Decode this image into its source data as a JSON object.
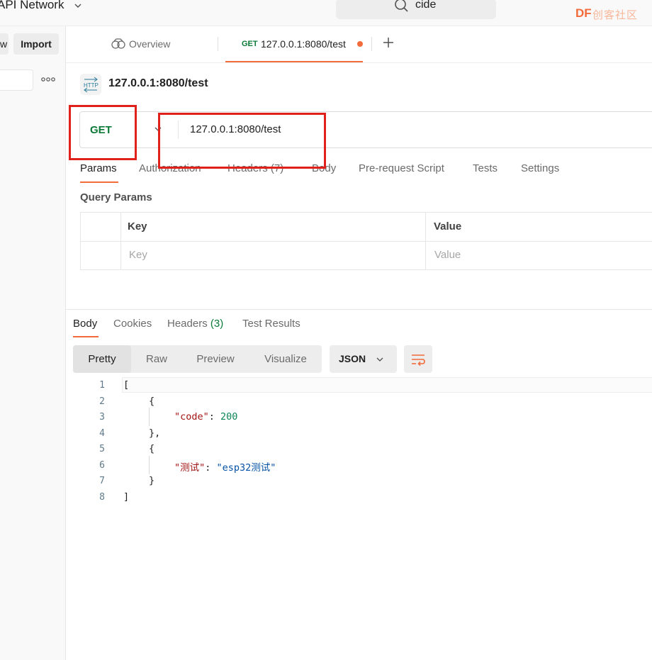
{
  "workspace": {
    "name": "API Network"
  },
  "search": {
    "value": "cide"
  },
  "brand": {
    "logo_text": "DF",
    "logo_sub": "创客社区"
  },
  "sidebar": {
    "left_button_label": "w",
    "import_label": "Import"
  },
  "tabs": {
    "overview_label": "Overview",
    "active_method": "GET",
    "active_url": "127.0.0.1:8080/test"
  },
  "request": {
    "title": "127.0.0.1:8080/test",
    "method": "GET",
    "url": "127.0.0.1:8080/test",
    "tabs": [
      "Params",
      "Authorization",
      "Headers (7)",
      "Body",
      "Pre-request Script",
      "Tests",
      "Settings"
    ],
    "active_tab": "Params",
    "query_params_title": "Query Params",
    "table": {
      "headers": [
        "Key",
        "Value"
      ],
      "placeholders": [
        "Key",
        "Value"
      ]
    }
  },
  "response": {
    "tabs": {
      "body": "Body",
      "cookies": "Cookies",
      "headers": "Headers",
      "headers_count": "(3)",
      "test_results": "Test Results"
    },
    "active_tab": "Body",
    "view_modes": [
      "Pretty",
      "Raw",
      "Preview",
      "Visualize"
    ],
    "active_view": "Pretty",
    "format": "JSON",
    "line_numbers": [
      "1",
      "2",
      "3",
      "4",
      "5",
      "6",
      "7",
      "8"
    ],
    "code": {
      "l1": "[",
      "l2": "{",
      "l3_key": "\"code\"",
      "l3_colon": ": ",
      "l3_value": "200",
      "l4": "},",
      "l5": "{",
      "l6_key": "\"测试\"",
      "l6_colon": ": ",
      "l6_value": "\"esp32测试\"",
      "l7": "}",
      "l8": "]"
    }
  },
  "colors": {
    "accent": "#f26b3a",
    "method_get": "#0b7a36",
    "annotation_red": "#e0211b"
  }
}
